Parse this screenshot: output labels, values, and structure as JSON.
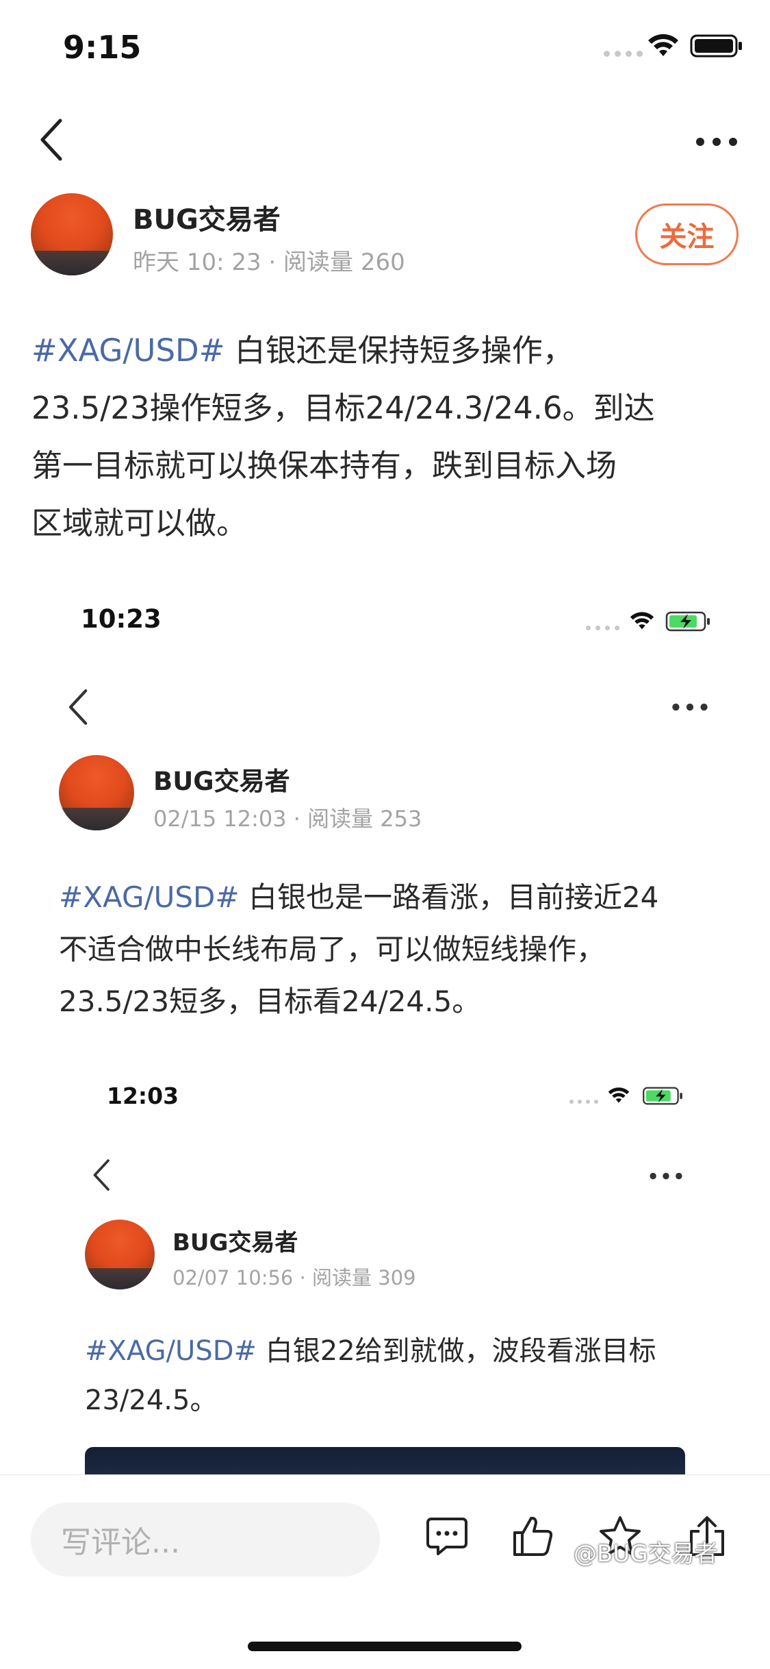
{
  "statusbar": {
    "time": "9:15"
  },
  "post": {
    "author": "BUG交易者",
    "meta": "昨天 10: 23 · 阅读量 260",
    "follow_label": "关注",
    "tag": "#XAG/USD#",
    "lines": [
      " 白银还是保持短多操作，",
      "23.5/23操作短多，目标24/24.3/24.6。到达",
      "第一目标就可以换保本持有，跌到目标入场",
      "区域就可以做。"
    ]
  },
  "screenshot1": {
    "time": "10:23",
    "author": "BUG交易者",
    "meta": "02/15 12:03 · 阅读量 253",
    "tag": "#XAG/USD#",
    "lines": [
      " 白银也是一路看涨，目前接近24",
      "不适合做中长线布局了，可以做短线操作，",
      "23.5/23短多，目标看24/24.5。"
    ]
  },
  "screenshot2": {
    "time": "12:03",
    "author": "BUG交易者",
    "meta": "02/07 10:56 · 阅读量 309",
    "tag": "#XAG/USD#",
    "lines": [
      " 白银22给到就做，波段看涨目标",
      "23/24.5。"
    ]
  },
  "bottom_bar": {
    "comment_placeholder": "写评论...",
    "icons": [
      "comment-icon",
      "like-icon",
      "favorite-icon",
      "share-icon"
    ]
  },
  "watermark": "@BUG交易者",
  "colors": {
    "accent": "#ee6a3c",
    "tag": "#4a6aa5",
    "meta": "#a3a3a3",
    "battery_charging": "#4cd964"
  }
}
